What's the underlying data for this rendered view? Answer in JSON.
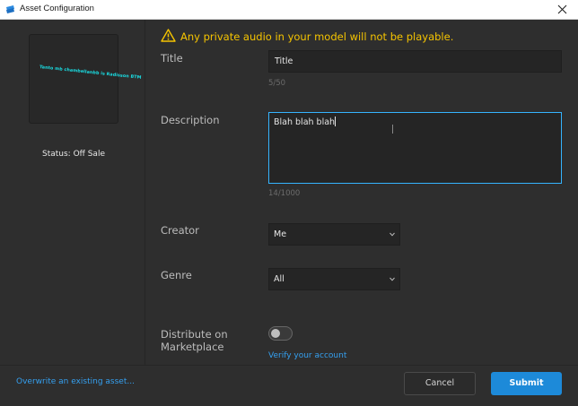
{
  "window": {
    "title": "Asset Configuration"
  },
  "left": {
    "thumbnail_text": "Tanto mb chambellanbb is Radisson BTM",
    "status": "Status: Off Sale"
  },
  "warning": {
    "text": "Any private audio in your model will not be playable.",
    "color": "#f5c400"
  },
  "form": {
    "title": {
      "label": "Title",
      "value": "Title",
      "counter": "5/50"
    },
    "description": {
      "label": "Description",
      "value": "Blah blah blah",
      "counter": "14/1000"
    },
    "creator": {
      "label": "Creator",
      "selected": "Me"
    },
    "genre": {
      "label": "Genre",
      "selected": "All"
    },
    "distribute": {
      "label_line1": "Distribute on",
      "label_line2": "Marketplace",
      "enabled": false,
      "link": "Verify your account"
    }
  },
  "footer": {
    "overwrite_link": "Overwrite an existing asset...",
    "cancel_label": "Cancel",
    "submit_label": "Submit"
  },
  "colors": {
    "accent": "#1d8ad9",
    "focus_border": "#35b4ff",
    "link": "#35a0f0",
    "thumbnail_text": "#19e0e6"
  }
}
